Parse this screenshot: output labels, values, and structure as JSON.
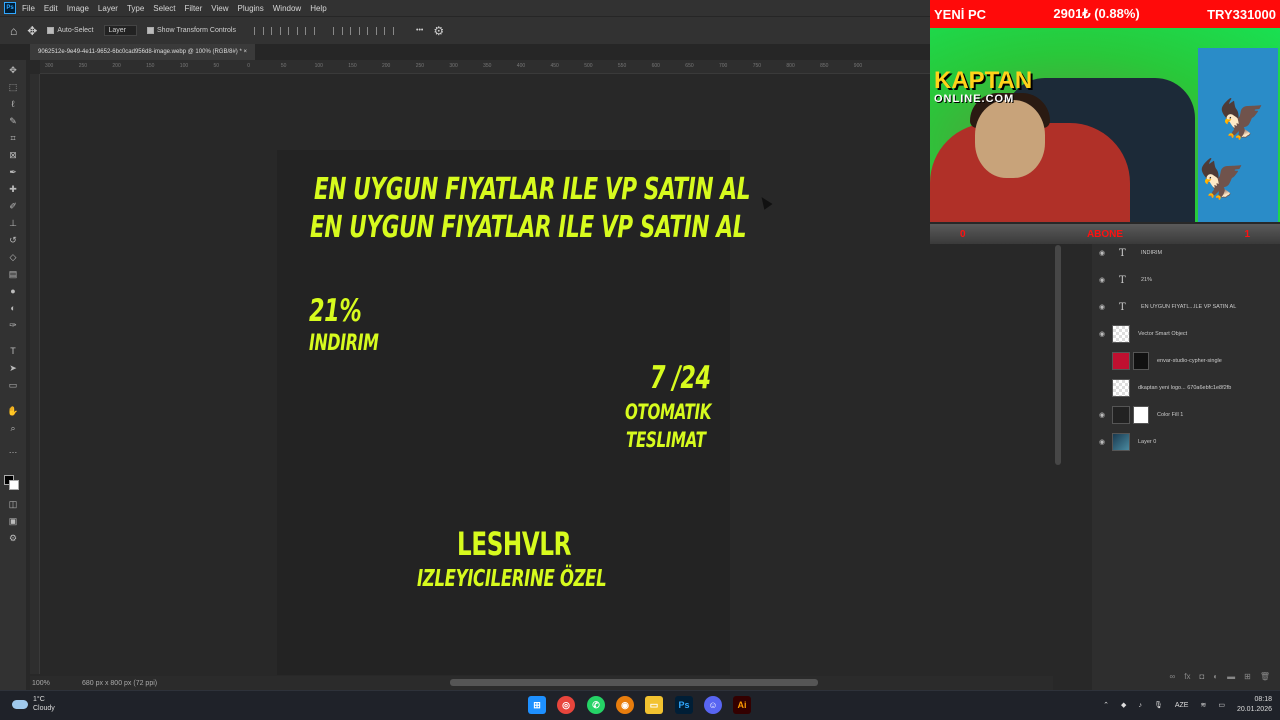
{
  "menu": {
    "items": [
      "File",
      "Edit",
      "Image",
      "Layer",
      "Type",
      "Select",
      "Filter",
      "View",
      "Plugins",
      "Window",
      "Help"
    ]
  },
  "options": {
    "auto_select": "Auto-Select",
    "layer_dropdown": "Layer",
    "transform_controls": "Show Transform Controls",
    "more": "•••"
  },
  "document": {
    "tab_title": "9062512e-9e49-4e11-9652-6bc0cad956d8-image.webp @ 100% (RGB/8#) *",
    "zoom": "100%",
    "info": "680 px x 800 px (72 ppi)"
  },
  "ruler_ticks": [
    "300",
    "250",
    "200",
    "150",
    "100",
    "50",
    "0",
    "50",
    "100",
    "150",
    "200",
    "250",
    "300",
    "350",
    "400",
    "450",
    "500",
    "550",
    "600",
    "650",
    "700",
    "750",
    "800",
    "850",
    "900"
  ],
  "poster": {
    "headline_1": "EN UYGUN FIYATLAR ILE VP SATIN AL",
    "headline_2": "EN UYGUN FIYATLAR ILE VP SATIN AL",
    "discount_pct": "21%",
    "discount_label": "INDIRIM",
    "hours": "7 /24",
    "auto_label": "OTOMATIK",
    "delivery_label": "TESLIMAT",
    "streamer_name": "LESHVLR",
    "viewers_label": "IZLEYICILERINE ÖZEL",
    "text_color": "#d7fb1e"
  },
  "layers": [
    {
      "name": "INDIRIM",
      "type": "text",
      "visible": true
    },
    {
      "name": "21%",
      "type": "text",
      "visible": true
    },
    {
      "name": "EN UYGUN FIYATL...ILE VP SATIN AL",
      "type": "text",
      "visible": true
    },
    {
      "name": "Vector Smart Object",
      "type": "smart",
      "visible": true
    },
    {
      "name": "envar-studio-cypher-single",
      "type": "masked",
      "visible": false
    },
    {
      "name": "dkaptan yeni logo... 670a6ebfc1e8f2fb",
      "type": "smart",
      "visible": false
    },
    {
      "name": "Color Fill 1",
      "type": "fill",
      "visible": true
    },
    {
      "name": "Layer 0",
      "type": "image",
      "visible": true
    }
  ],
  "stream": {
    "title": "YENİ PC",
    "price_change": "2901₺ (0.88%)",
    "ticker": "TRY331000",
    "brand": "KAPTAN",
    "brand_sub": "ONLINE.COM",
    "counter_left": "0",
    "counter_label": "ABONE",
    "counter_right": "1",
    "bar_color": "#ff0a0a"
  },
  "taskbar": {
    "temperature": "1°C",
    "weather": "Cloudy",
    "language": "AZE",
    "time": "08:18",
    "date": "20.01.2026"
  }
}
